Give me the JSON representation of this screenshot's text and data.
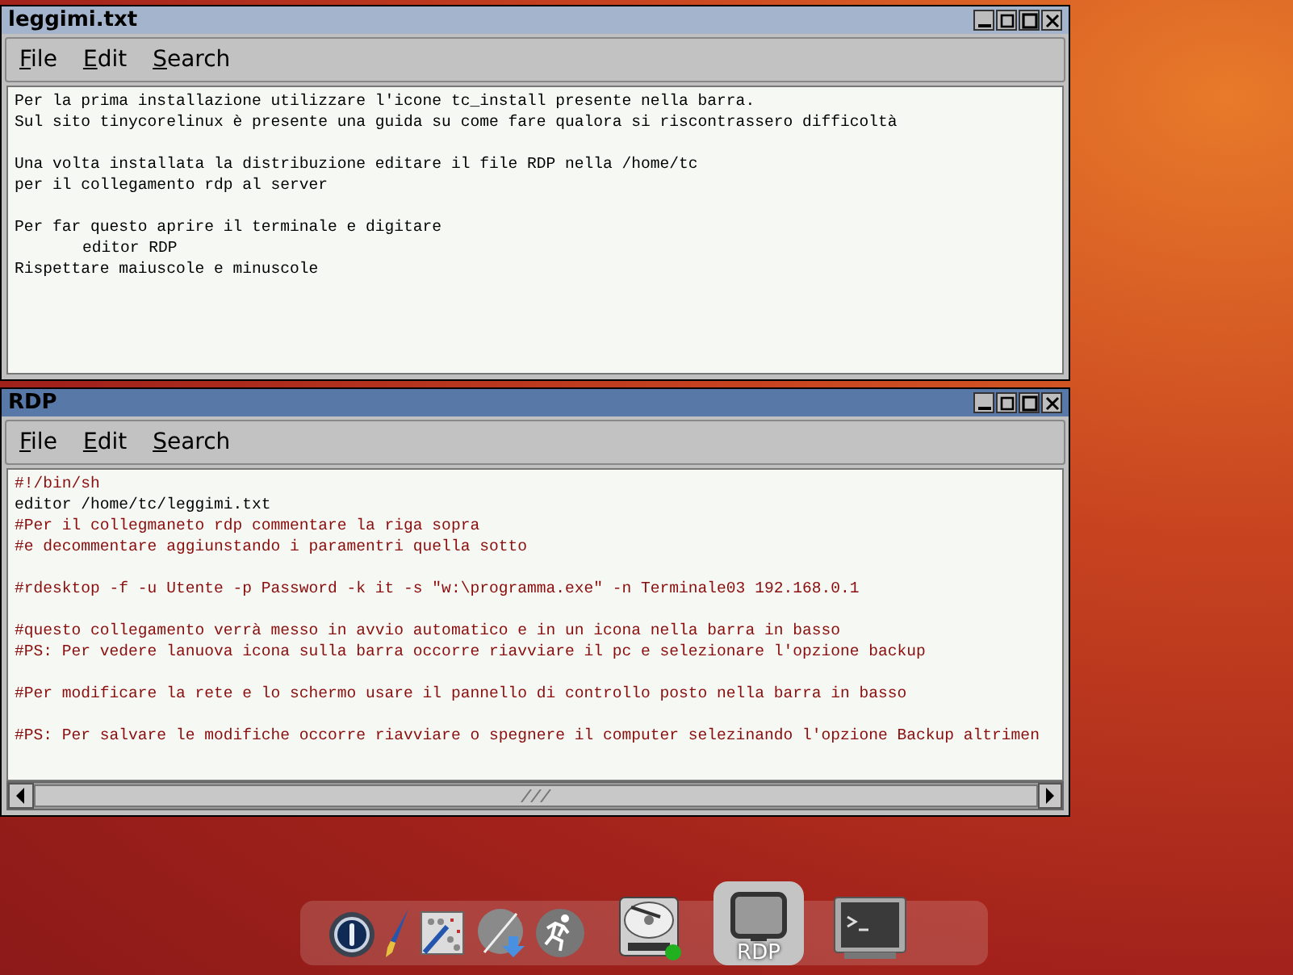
{
  "windows": [
    {
      "title": "leggimi.txt",
      "active": false,
      "menu": [
        "File",
        "Edit",
        "Search"
      ],
      "horizontal_scrollbar": false,
      "paragraphs": [
        [
          {
            "text": "Per la prima installazione utilizzare l'icone tc_install presente nella barra.",
            "kind": "plain"
          },
          {
            "text": "Sul sito tinycorelinux è presente una guida su come fare qualora si riscontrassero difficoltà",
            "kind": "plain"
          }
        ],
        [
          {
            "text": "Una volta installata la distribuzione editare il file RDP nella /home/tc",
            "kind": "plain"
          },
          {
            "text": "per il collegamento rdp al server",
            "kind": "plain"
          }
        ],
        [
          {
            "text": "Per far questo aprire il terminale e digitare",
            "kind": "plain"
          },
          {
            "text": "editor RDP",
            "kind": "indented"
          },
          {
            "text": "Rispettare maiuscole e minuscole",
            "kind": "plain"
          }
        ]
      ]
    },
    {
      "title": "RDP",
      "active": true,
      "menu": [
        "File",
        "Edit",
        "Search"
      ],
      "horizontal_scrollbar": true,
      "paragraphs": [
        [
          {
            "text": "#!/bin/sh",
            "kind": "comment"
          },
          {
            "text": "editor /home/tc/leggimi.txt",
            "kind": "plain"
          },
          {
            "text": "#Per il collegmaneto rdp commentare la riga sopra",
            "kind": "comment"
          },
          {
            "text": "#e decommentare aggiunstando i paramentri quella sotto",
            "kind": "comment"
          }
        ],
        [
          {
            "text": "#rdesktop -f -u Utente -p Password -k it -s \"w:\\programma.exe\" -n Terminale03 192.168.0.1",
            "kind": "comment"
          }
        ],
        [
          {
            "text": "#questo collegamento verrà messo in avvio automatico e in un icona nella barra in basso",
            "kind": "comment"
          },
          {
            "text": "#PS: Per vedere lanuova icona sulla barra occorre riavviare il pc e selezionare l'opzione backup",
            "kind": "comment"
          }
        ],
        [
          {
            "text": "#Per modificare la rete e lo schermo usare il pannello di controllo posto nella barra in basso",
            "kind": "comment"
          }
        ],
        [
          {
            "text": "#PS: Per salvare le modifiche occorre riavviare o spegnere il computer selezinando l'opzione Backup altrimen",
            "kind": "comment"
          }
        ]
      ]
    }
  ],
  "dock": [
    {
      "kind": "power",
      "selected": false
    },
    {
      "kind": "brush",
      "selected": false
    },
    {
      "kind": "tools",
      "selected": false
    },
    {
      "kind": "install",
      "selected": false
    },
    {
      "kind": "runner",
      "selected": false
    },
    {
      "kind": "disk",
      "selected": false
    },
    {
      "kind": "window",
      "selected": true,
      "label": "RDP"
    },
    {
      "kind": "terminal",
      "selected": false
    }
  ]
}
